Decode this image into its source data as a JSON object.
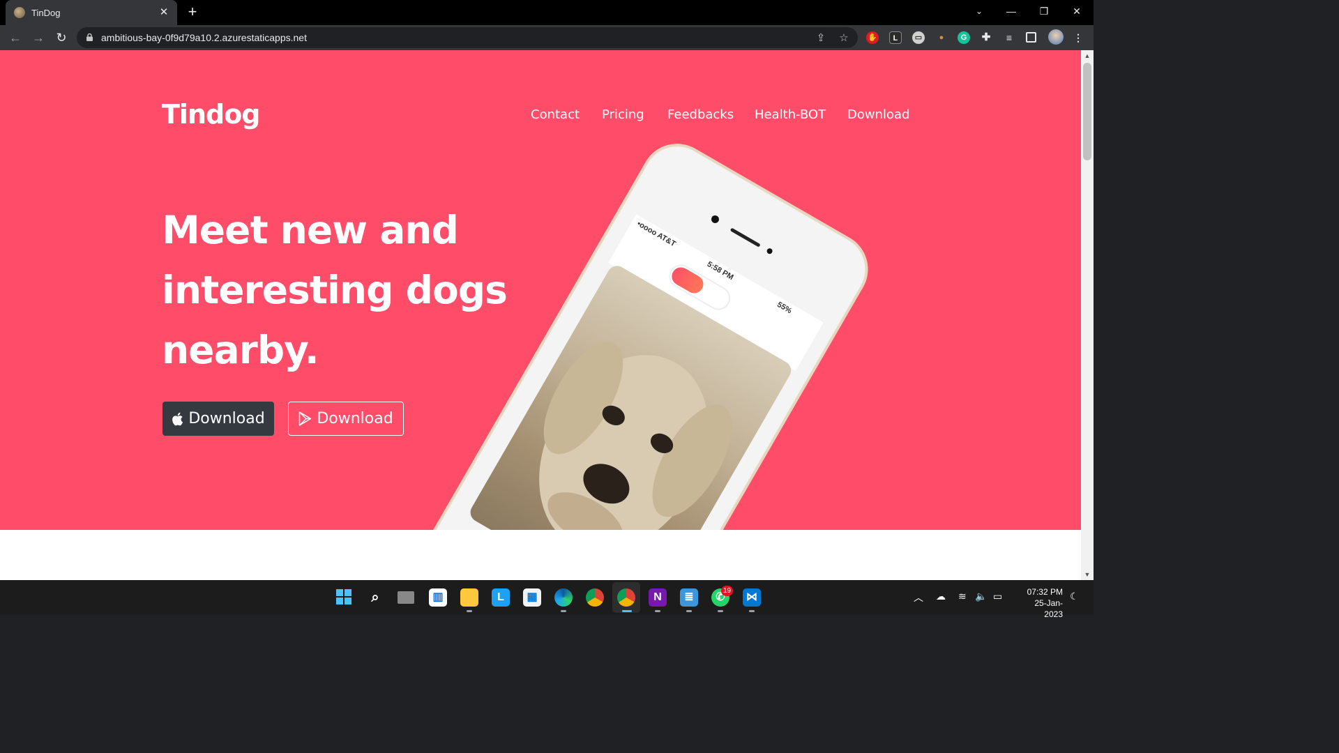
{
  "browser": {
    "tab_title": "TinDog",
    "url": "ambitious-bay-0f9d79a10.2.azurestaticapps.net"
  },
  "page": {
    "brand": "Tindog",
    "nav": [
      "Contact",
      "Pricing",
      "Feedbacks",
      "Health-BOT",
      "Download"
    ],
    "headline_lines": [
      "Meet new and",
      "interesting dogs",
      "nearby."
    ],
    "buttons": {
      "apple_download": "Download",
      "play_download": "Download"
    },
    "phone": {
      "carrier": "•oooo AT&T",
      "time": "5:58 PM",
      "battery": "55%"
    },
    "hero_color": "#ff4c68"
  },
  "taskbar": {
    "whatsapp_badge": "19",
    "time": "07:32 PM",
    "date": "25-Jan-2023"
  }
}
